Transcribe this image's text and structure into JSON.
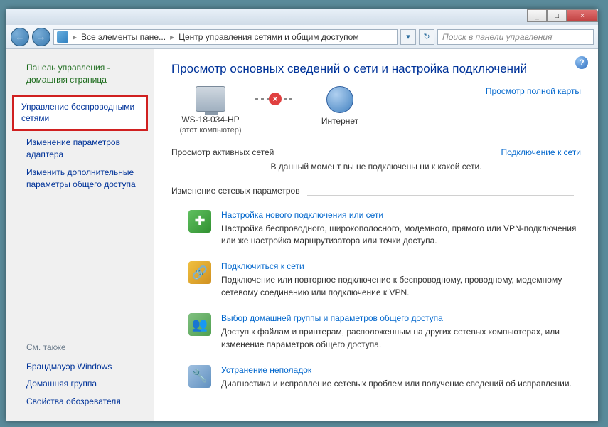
{
  "titlebar": {
    "min": "_",
    "max": "□",
    "close": "×"
  },
  "nav": {
    "back": "←",
    "fwd": "→",
    "breadcrumb1": "Все элементы пане...",
    "breadcrumb2": "Центр управления сетями и общим доступом",
    "sep": "▸",
    "refresh": "↻",
    "search_placeholder": "Поиск в панели управления"
  },
  "sidebar": {
    "home": "Панель управления - домашняя страница",
    "links": [
      "Управление беспроводными сетями",
      "Изменение параметров адаптера",
      "Изменить дополнительные параметры общего доступа"
    ],
    "see_also_heading": "См. также",
    "see_also": [
      "Брандмауэр Windows",
      "Домашняя группа",
      "Свойства обозревателя"
    ]
  },
  "main": {
    "help": "?",
    "title": "Просмотр основных сведений о сети и настройка подключений",
    "full_map": "Просмотр полной карты",
    "node_pc": "WS-18-034-HP",
    "node_pc_sub": "(этот компьютер)",
    "node_internet": "Интернет",
    "conn_x": "×",
    "active_label": "Просмотр активных сетей",
    "connect_link": "Подключение к сети",
    "no_conn_msg": "В данный момент вы не подключены ни к какой сети.",
    "settings_heading": "Изменение сетевых параметров",
    "settings": [
      {
        "title": "Настройка нового подключения или сети",
        "desc": "Настройка беспроводного, широкополосного, модемного, прямого или VPN-подключения или же настройка маршрутизатора или точки доступа."
      },
      {
        "title": "Подключиться к сети",
        "desc": "Подключение или повторное подключение к беспроводному, проводному, модемному сетевому соединению или подключение к VPN."
      },
      {
        "title": "Выбор домашней группы и параметров общего доступа",
        "desc": "Доступ к файлам и принтерам, расположенным на других сетевых компьютерах, или изменение параметров общего доступа."
      },
      {
        "title": "Устранение неполадок",
        "desc": "Диагностика и исправление сетевых проблем или получение сведений об исправлении."
      }
    ]
  }
}
